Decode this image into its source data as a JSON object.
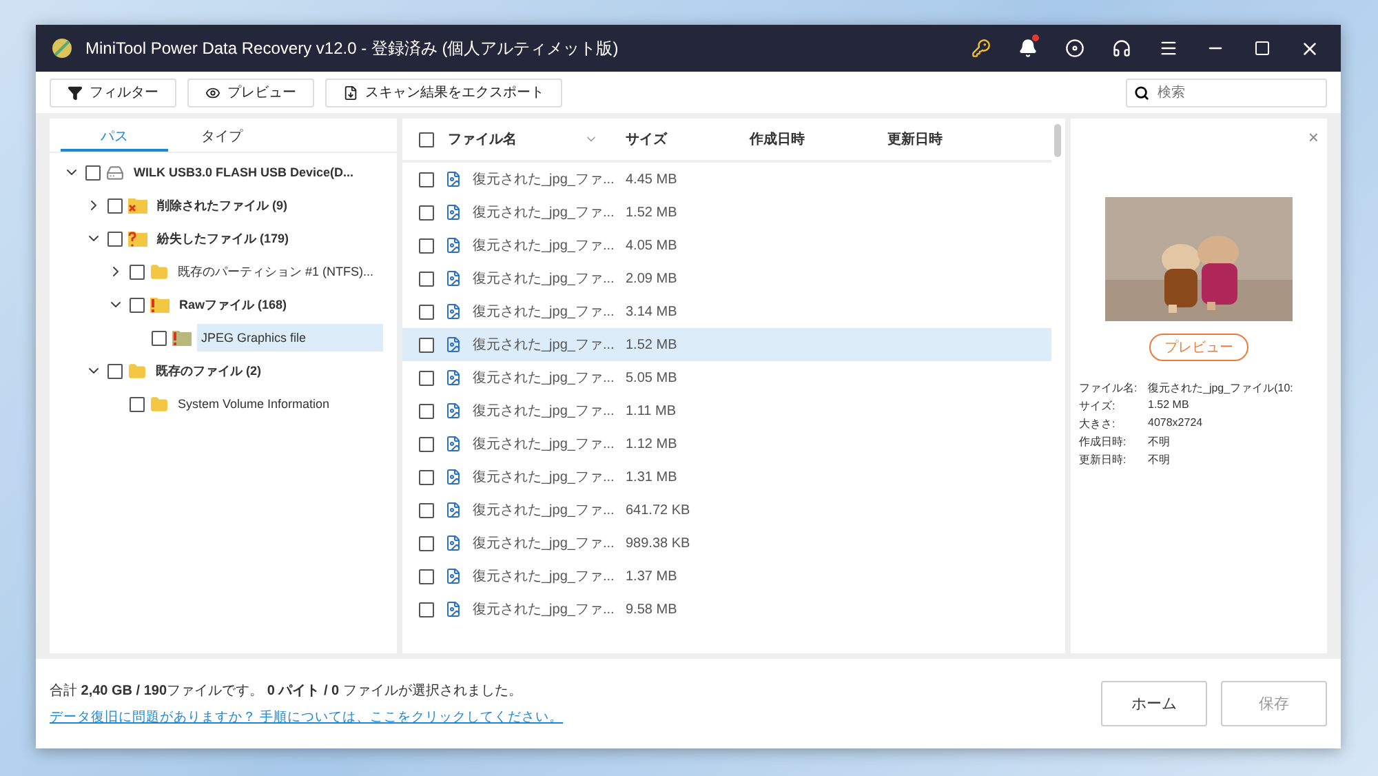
{
  "window": {
    "title": "MiniTool Power Data Recovery v12.0 - 登録済み (個人アルティメット版)"
  },
  "toolbar": {
    "buttons": [
      {
        "kind": "filter",
        "label": "フィルター"
      },
      {
        "kind": "preview",
        "label": "プレビュー"
      },
      {
        "kind": "export",
        "label": "スキャン結果をエクスポート"
      }
    ],
    "search": {
      "placeholder": "検索"
    }
  },
  "view_tabs": [
    {
      "label": "パス",
      "selected": true
    },
    {
      "label": "タイプ",
      "selected": false
    }
  ],
  "tree": [
    {
      "kind": "drive",
      "label": "WILK USB3.0 FLASH USB Device(D...",
      "checked": false,
      "expanded": true,
      "selected": false,
      "children": [
        {
          "kind": "deleted",
          "label": "削除されたファイル (9)",
          "checked": false,
          "expanded": false,
          "selected": false
        },
        {
          "kind": "lost",
          "label": "紛失したファイル (179)",
          "checked": false,
          "expanded": true,
          "selected": false,
          "children": [
            {
              "kind": "partition",
              "label": "既存のパーティション #1 (NTFS)...",
              "checked": false,
              "expanded": false,
              "selected": false
            },
            {
              "kind": "raw",
              "label": "Rawファイル (168)",
              "checked": false,
              "expanded": true,
              "selected": false,
              "children": [
                {
                  "kind": "jpeg",
                  "label": "JPEG Graphics file",
                  "checked": false,
                  "selected": true
                }
              ]
            }
          ]
        },
        {
          "kind": "existing",
          "label": "既存のファイル (2)",
          "checked": false,
          "expanded": true,
          "selected": false,
          "children": [
            {
              "kind": "folder",
              "label": "System Volume Information",
              "checked": false,
              "selected": false
            }
          ]
        }
      ]
    }
  ],
  "table": {
    "columns": [
      "ファイル名",
      "サイズ",
      "作成日時",
      "更新日時"
    ],
    "all_checked": false,
    "rows": [
      {
        "name": "復元された_jpg_ファ...",
        "size": "4.45 MB",
        "checked": false,
        "selected": false
      },
      {
        "name": "復元された_jpg_ファ...",
        "size": "1.52 MB",
        "checked": false,
        "selected": false
      },
      {
        "name": "復元された_jpg_ファ...",
        "size": "4.05 MB",
        "checked": false,
        "selected": false
      },
      {
        "name": "復元された_jpg_ファ...",
        "size": "2.09 MB",
        "checked": false,
        "selected": false
      },
      {
        "name": "復元された_jpg_ファ...",
        "size": "3.14 MB",
        "checked": false,
        "selected": false
      },
      {
        "name": "復元された_jpg_ファ...",
        "size": "1.52 MB",
        "checked": false,
        "selected": true
      },
      {
        "name": "復元された_jpg_ファ...",
        "size": "5.05 MB",
        "checked": false,
        "selected": false
      },
      {
        "name": "復元された_jpg_ファ...",
        "size": "1.11 MB",
        "checked": false,
        "selected": false
      },
      {
        "name": "復元された_jpg_ファ...",
        "size": "1.12 MB",
        "checked": false,
        "selected": false
      },
      {
        "name": "復元された_jpg_ファ...",
        "size": "1.31 MB",
        "checked": false,
        "selected": false
      },
      {
        "name": "復元された_jpg_ファ...",
        "size": "641.72 KB",
        "checked": false,
        "selected": false
      },
      {
        "name": "復元された_jpg_ファ...",
        "size": "989.38 KB",
        "checked": false,
        "selected": false
      },
      {
        "name": "復元された_jpg_ファ...",
        "size": "1.37 MB",
        "checked": false,
        "selected": false
      },
      {
        "name": "復元された_jpg_ファ...",
        "size": "9.58 MB",
        "checked": false,
        "selected": false
      }
    ]
  },
  "preview": {
    "close": "×",
    "button": "プレビュー",
    "info": [
      {
        "label": "ファイル名:",
        "value": "復元された_jpg_ファイル(10:"
      },
      {
        "label": "サイズ:",
        "value": "1.52 MB"
      },
      {
        "label": "大きさ:",
        "value": "4078x2724"
      },
      {
        "label": "作成日時:",
        "value": "不明"
      },
      {
        "label": "更新日時:",
        "value": "不明"
      }
    ]
  },
  "footer": {
    "summary": "合計 **2,40 GB / 190**ファイルです。 **0 パイト / 0** ファイルが選択されました。",
    "help_link": "データ復旧に問題がありますか？ 手順については、ここをクリックしてください。",
    "buttons": [
      {
        "label": "ホーム",
        "disabled": false
      },
      {
        "label": "保存",
        "disabled": true
      }
    ]
  }
}
